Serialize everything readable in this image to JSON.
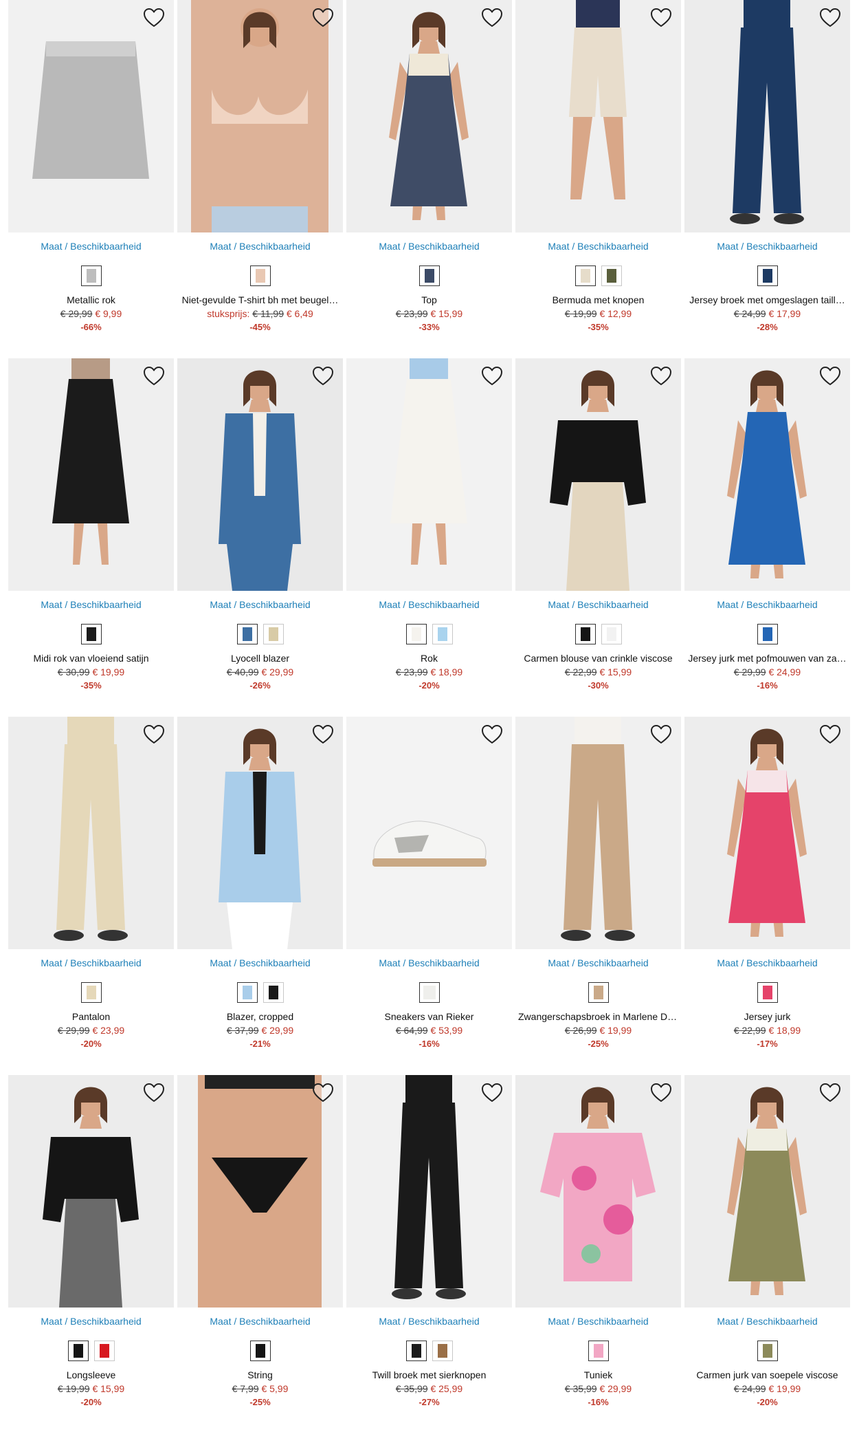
{
  "common": {
    "size_link": "Maat / Beschikbaarheid",
    "unit_label": "stuksprijs:"
  },
  "products": [
    {
      "name": "Metallic rok",
      "old": "€ 29,99",
      "new": "€ 9,99",
      "disc": "-66%",
      "bg": "#f1f1f1",
      "shape": "skirt",
      "c1": "#b9b9b9",
      "c2": "",
      "skin": false,
      "swatches": [
        "#bdbdbd"
      ]
    },
    {
      "name": "Niet-gevulde T-shirt bh met beugel…",
      "unit": true,
      "old": "€ 11,99",
      "new": "€ 6,49",
      "disc": "-45%",
      "bg": "#eeeeee",
      "shape": "bra",
      "c1": "#f0d4c2",
      "c2": "#b9cde0",
      "skin": true,
      "swatches": [
        "#e9c8b3"
      ]
    },
    {
      "name": "Top",
      "old": "€ 23,99",
      "new": "€ 15,99",
      "disc": "-33%",
      "bg": "#eeeeee",
      "shape": "dress",
      "c1": "#3f4c66",
      "c2": "#efe8d8",
      "skin": true,
      "swatches": [
        "#3b4a66"
      ]
    },
    {
      "name": "Bermuda met knopen",
      "old": "€ 19,99",
      "new": "€ 12,99",
      "disc": "-35%",
      "bg": "#efefef",
      "shape": "shorts",
      "c1": "#e8ddcc",
      "c2": "#2b3557",
      "skin": true,
      "swatches": [
        "#e6dcca",
        "#5a5f3c"
      ]
    },
    {
      "name": "Jersey broek met omgeslagen taill…",
      "old": "€ 24,99",
      "new": "€ 17,99",
      "disc": "-28%",
      "bg": "#ececec",
      "shape": "pants",
      "c1": "#1d3a63",
      "c2": "#1d3a63",
      "skin": false,
      "swatches": [
        "#1d3a63"
      ]
    },
    {
      "name": "Midi rok van vloeiend satijn",
      "old": "€ 30,99",
      "new": "€ 19,99",
      "disc": "-35%",
      "bg": "#efefef",
      "shape": "midiskirt",
      "c1": "#1b1b1b",
      "c2": "#b79b86",
      "skin": true,
      "swatches": [
        "#1b1b1b"
      ]
    },
    {
      "name": "Lyocell blazer",
      "old": "€ 40,99",
      "new": "€ 29,99",
      "disc": "-26%",
      "bg": "#e9e9e9",
      "shape": "blazer",
      "c1": "#3d6fa3",
      "c2": "#f3efe8",
      "skin": true,
      "swatches": [
        "#3d6fa3",
        "#d8cba6"
      ]
    },
    {
      "name": "Rok",
      "old": "€ 23,99",
      "new": "€ 18,99",
      "disc": "-20%",
      "bg": "#f2f2f2",
      "shape": "midiskirt",
      "c1": "#f5f3ee",
      "c2": "#a8cbe8",
      "skin": true,
      "swatches": [
        "#f5f3ee",
        "#a9d3ee"
      ]
    },
    {
      "name": "Carmen blouse van crinkle viscose",
      "old": "€ 22,99",
      "new": "€ 15,99",
      "disc": "-30%",
      "bg": "#ededed",
      "shape": "blouse",
      "c1": "#151515",
      "c2": "#e3d6bf",
      "skin": true,
      "swatches": [
        "#151515",
        "#f2f2f2"
      ]
    },
    {
      "name": "Jersey jurk met pofmouwen van za…",
      "old": "€ 29,99",
      "new": "€ 24,99",
      "disc": "-16%",
      "bg": "#efefef",
      "shape": "dress",
      "c1": "#2466b5",
      "c2": "#2466b5",
      "skin": true,
      "swatches": [
        "#2466b5"
      ]
    },
    {
      "name": "Pantalon",
      "old": "€ 29,99",
      "new": "€ 23,99",
      "disc": "-20%",
      "bg": "#ededed",
      "shape": "pants",
      "c1": "#e5d8b9",
      "c2": "#e5d8b9",
      "skin": true,
      "swatches": [
        "#e5d8b9"
      ]
    },
    {
      "name": "Blazer, cropped",
      "old": "€ 37,99",
      "new": "€ 29,99",
      "disc": "-21%",
      "bg": "#ececec",
      "shape": "blazer",
      "c1": "#a9cdea",
      "c2": "#1a1a1a",
      "skin": true,
      "swatches": [
        "#a9cdea",
        "#1a1a1a"
      ]
    },
    {
      "name": "Sneakers van Rieker",
      "old": "€ 64,99",
      "new": "€ 53,99",
      "disc": "-16%",
      "bg": "#f3f3f3",
      "shape": "shoe",
      "c1": "#f5f5f3",
      "c2": "#b4b4b0",
      "skin": false,
      "swatches": [
        "#efefec"
      ]
    },
    {
      "name": "Zwangerschapsbroek in Marlene Di…",
      "old": "€ 26,99",
      "new": "€ 19,99",
      "disc": "-25%",
      "bg": "#f0f0f0",
      "shape": "pants",
      "c1": "#caa988",
      "c2": "#f4f2ee",
      "skin": false,
      "swatches": [
        "#caa988"
      ]
    },
    {
      "name": "Jersey jurk",
      "old": "€ 22,99",
      "new": "€ 18,99",
      "disc": "-17%",
      "bg": "#ededed",
      "shape": "dress",
      "c1": "#e5436a",
      "c2": "#f6e4e8",
      "skin": true,
      "swatches": [
        "#e5436a"
      ]
    },
    {
      "name": "Longsleeve",
      "old": "€ 19,99",
      "new": "€ 15,99",
      "disc": "-20%",
      "bg": "#ececec",
      "shape": "blouse",
      "c1": "#151515",
      "c2": "#6a6a6a",
      "skin": true,
      "swatches": [
        "#151515",
        "#d71920"
      ]
    },
    {
      "name": "String",
      "old": "€ 7,99",
      "new": "€ 5,99",
      "disc": "-25%",
      "bg": "#efefef",
      "shape": "string",
      "c1": "#151515",
      "c2": "#151515",
      "skin": true,
      "swatches": [
        "#151515"
      ]
    },
    {
      "name": "Twill broek met sierknopen",
      "old": "€ 35,99",
      "new": "€ 25,99",
      "disc": "-27%",
      "bg": "#f1f1f1",
      "shape": "pants",
      "c1": "#1a1a1a",
      "c2": "#1a1a1a",
      "skin": false,
      "swatches": [
        "#1a1a1a",
        "#9a6f47"
      ]
    },
    {
      "name": "Tuniek",
      "old": "€ 35,99",
      "new": "€ 29,99",
      "disc": "-16%",
      "bg": "#ececec",
      "shape": "tunic",
      "c1": "#f2a7c4",
      "c2": "#e55c9b",
      "skin": true,
      "swatches": [
        "#f2a7c4"
      ]
    },
    {
      "name": "Carmen jurk van soepele viscose",
      "old": "€ 24,99",
      "new": "€ 19,99",
      "disc": "-20%",
      "bg": "#ededed",
      "shape": "dress",
      "c1": "#8c8a5a",
      "c2": "#efeee2",
      "skin": true,
      "swatches": [
        "#8c8a5a"
      ]
    }
  ]
}
